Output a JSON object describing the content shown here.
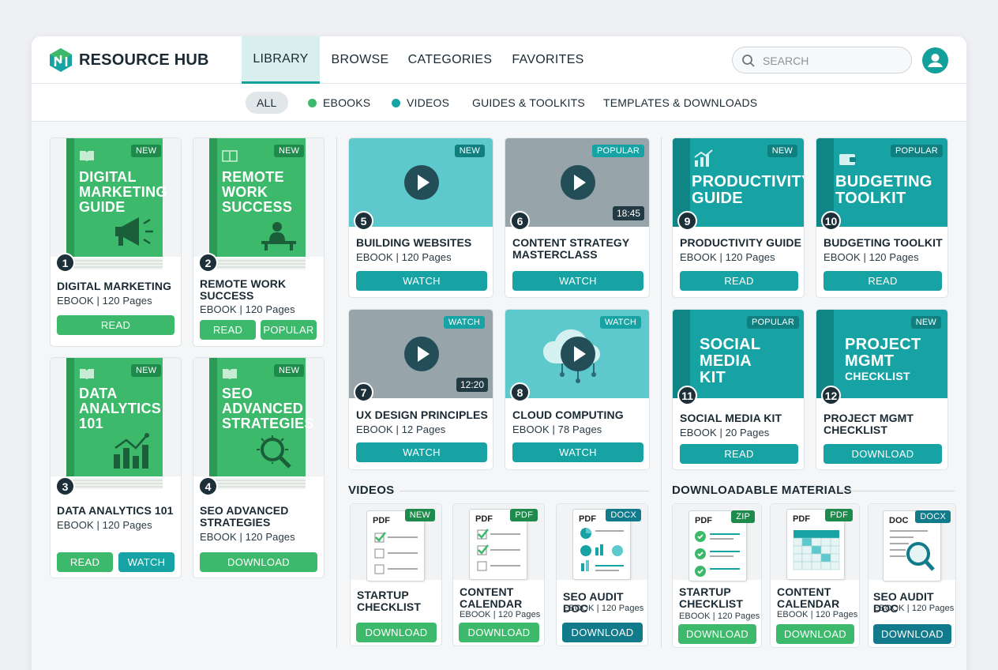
{
  "app": {
    "brand": "RESOURCE HUB"
  },
  "nav": {
    "items": [
      "LIBRARY",
      "BROWSE",
      "CATEGORIES",
      "FAVORITES"
    ],
    "active": "LIBRARY"
  },
  "search": {
    "placeholder": "SEARCH"
  },
  "filters": {
    "all": "ALL",
    "ebooks": "EBOOKS",
    "videos": "VIDEOS",
    "guides": "GUIDES & TOOLKITS",
    "templates": "TEMPLATES & DOWNLOADS"
  },
  "colors": {
    "accent_teal": "#17a3a3",
    "accent_green": "#3cb96a",
    "dark_teal": "#117a8b"
  },
  "ebooks": [
    {
      "num": "1",
      "badge": "NEW",
      "cover": "DIGITAL MARKETING GUIDE",
      "title": "DIGITAL MARKETING",
      "meta": "EBOOK | 120 Pages",
      "btn1": "READ"
    },
    {
      "num": "2",
      "badge": "NEW",
      "cover": "REMOTE WORK SUCCESS",
      "title": "REMOTE WORK SUCCESS",
      "meta": "EBOOK | 120 Pages",
      "btn1": "READ",
      "btn2": "POPULAR"
    },
    {
      "num": "3",
      "badge": "NEW",
      "cover": "DATA ANALYTICS 101",
      "title": "DATA ANALYTICS 101",
      "meta": "EBOOK | 120 Pages",
      "btn1": "READ",
      "btn2": "WATCH"
    },
    {
      "num": "4",
      "badge": "NEW",
      "cover": "SEO ADVANCED STRATEGIES",
      "title": "SEO ADVANCED STRATEGIES",
      "meta": "EBOOK | 120 Pages",
      "btn1": "DOWNLOAD"
    }
  ],
  "videos": [
    {
      "num": "5",
      "badge": "NEW",
      "title": "BUILDING WEBSITES",
      "meta": "EBOOK | 120 Pages",
      "btn": "WATCH"
    },
    {
      "num": "6",
      "badge": "POPULAR",
      "duration": "18:45",
      "title": "CONTENT STRATEGY MASTERCLASS",
      "btn": "WATCH"
    },
    {
      "num": "7",
      "badge": "WATCH",
      "duration": "12:20",
      "title": "UX DESIGN PRINCIPLES",
      "meta": "EBOOK | 12 Pages",
      "btn": "WATCH"
    },
    {
      "num": "8",
      "badge": "WATCH",
      "title": "CLOUD COMPUTING",
      "meta": "EBOOK | 78 Pages",
      "btn": "WATCH"
    }
  ],
  "guides": [
    {
      "num": "9",
      "badge": "NEW",
      "cover": "PRODUCTIVITY GUIDE",
      "title": "PRODUCTIVITY GUIDE",
      "meta": "EBOOK | 120 Pages",
      "btn": "READ"
    },
    {
      "num": "10",
      "badge": "POPULAR",
      "cover": "BUDGETING TOOLKIT",
      "title": "BUDGETING TOOLKIT",
      "meta": "EBOOK | 120 Pages",
      "btn": "READ"
    },
    {
      "num": "11",
      "badge": "POPULAR",
      "cover": "SOCIAL MEDIA KIT",
      "title": "SOCIAL MEDIA KIT",
      "meta": "EBOOK | 20 Pages",
      "btn": "READ"
    },
    {
      "num": "12",
      "badge": "NEW",
      "cover_main": "PROJECT MGMT",
      "cover_sub": "CHECKLIST",
      "title": "PROJECT MGMT CHECKLIST",
      "btn": "DOWNLOAD"
    }
  ],
  "sections": {
    "videos": "VIDEOS",
    "downloads": "DOWNLOADABLE MATERIALS"
  },
  "video_docs": [
    {
      "type": "PDF",
      "badge": "NEW",
      "title": "STARTUP CHECKLIST",
      "btn": "DOWNLOAD"
    },
    {
      "type": "PDF",
      "badge": "PDF",
      "title": "CONTENT CALENDAR",
      "meta": "EBOOK | 120 Pages",
      "btn": "DOWNLOAD"
    },
    {
      "type": "PDF",
      "badge": "DOCX",
      "title": "SEO AUDIT DOC",
      "meta": "EBOOK | 120 Pages",
      "btn": "DOWNLOAD"
    }
  ],
  "download_docs": [
    {
      "type": "PDF",
      "badge": "ZIP",
      "title": "STARTUP CHECKLIST",
      "meta": "EBOOK | 120 Pages",
      "btn": "DOWNLOAD"
    },
    {
      "type": "PDF",
      "badge": "PDF",
      "title": "CONTENT CALENDAR",
      "meta": "EBOOK | 120 Pages",
      "btn": "DOWNLOAD"
    },
    {
      "type": "DOC",
      "badge": "DOCX",
      "title": "SEO AUDIT DOC",
      "meta": "EBOOK | 120 Pages",
      "btn": "DOWNLOAD"
    }
  ]
}
